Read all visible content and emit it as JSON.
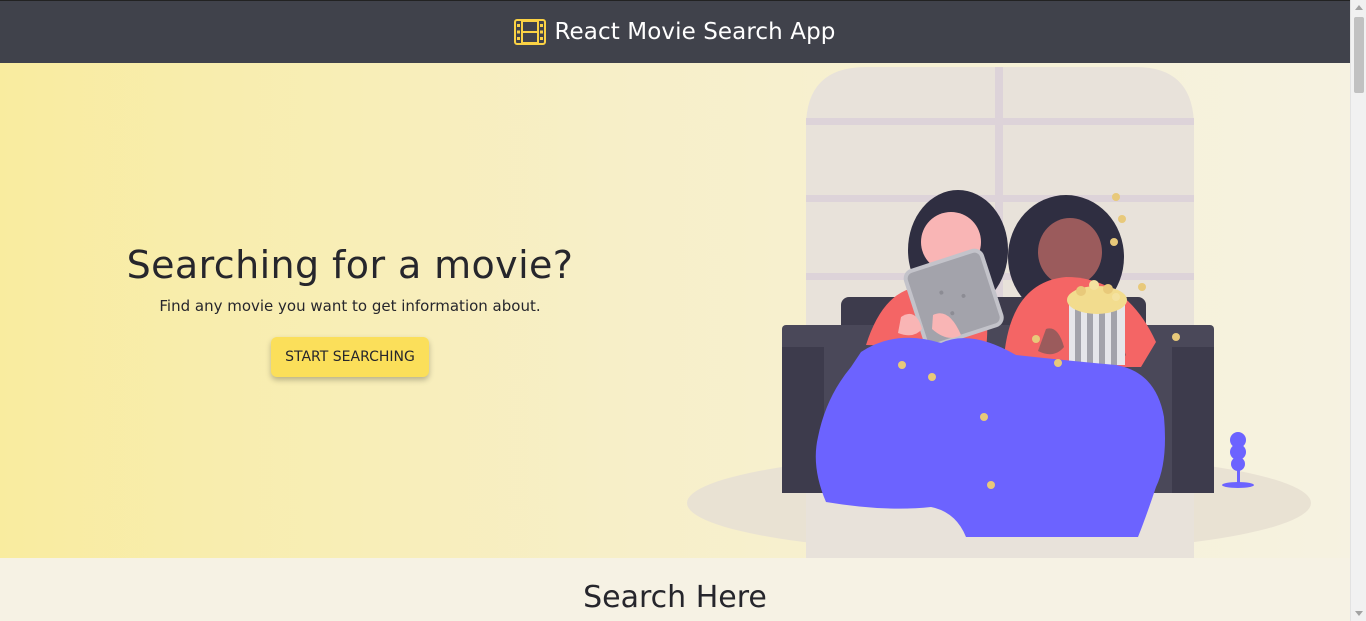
{
  "navbar": {
    "brand": "React Movie Search App",
    "icon": "film-icon",
    "background": "#40424b",
    "accent": "#fbdf5a"
  },
  "hero": {
    "title": "Searching for a movie?",
    "subtitle": "Find any movie you want to get information about.",
    "cta_label": "START SEARCHING",
    "illustration": "two-people-watching-movie-on-couch"
  },
  "search": {
    "title": "Search Here"
  },
  "colors": {
    "hero_gradient_start": "#f9ec9f",
    "hero_gradient_end": "#f6f2e1",
    "button": "#fbdf5a",
    "blanket": "#6c63ff",
    "couch": "#4a4859"
  }
}
